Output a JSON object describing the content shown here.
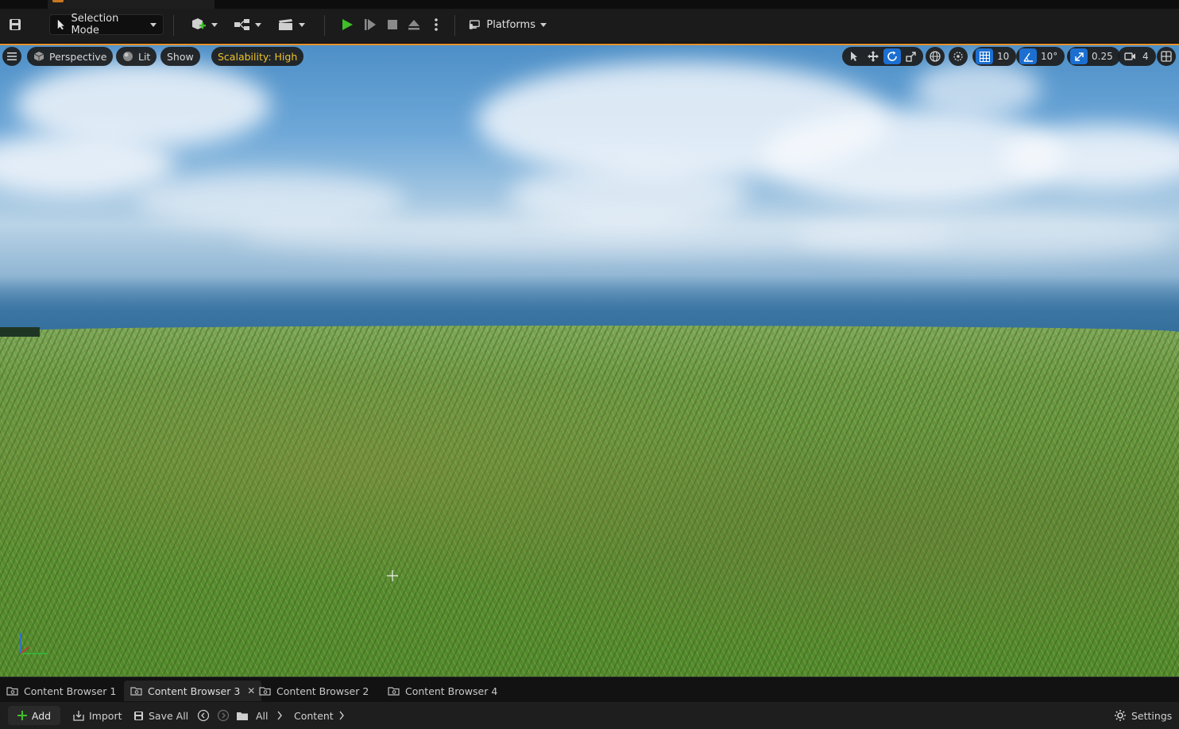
{
  "toolbar": {
    "selection_mode_label": "Selection Mode",
    "platforms_label": "Platforms"
  },
  "viewport": {
    "perspective_label": "Perspective",
    "lit_label": "Lit",
    "show_label": "Show",
    "scalability_label": "Scalability: High",
    "grid_snap_value": "10",
    "rotation_snap_value": "10°",
    "scale_snap_value": "0.25",
    "camera_speed_value": "4"
  },
  "bottom_tabs": [
    {
      "label": "Content Browser 1"
    },
    {
      "label": "Content Browser 3"
    },
    {
      "label": "Content Browser 2"
    },
    {
      "label": "Content Browser 4"
    }
  ],
  "content_toolbar": {
    "add_label": "Add",
    "import_label": "Import",
    "save_all_label": "Save All",
    "path_all": "All",
    "path_content": "Content",
    "settings_label": "Settings"
  },
  "colors": {
    "accent_orange": "#e7922a",
    "play_green": "#3fbf2a",
    "active_blue": "#1c6fd1",
    "scalability_yellow": "#f0c22a"
  }
}
